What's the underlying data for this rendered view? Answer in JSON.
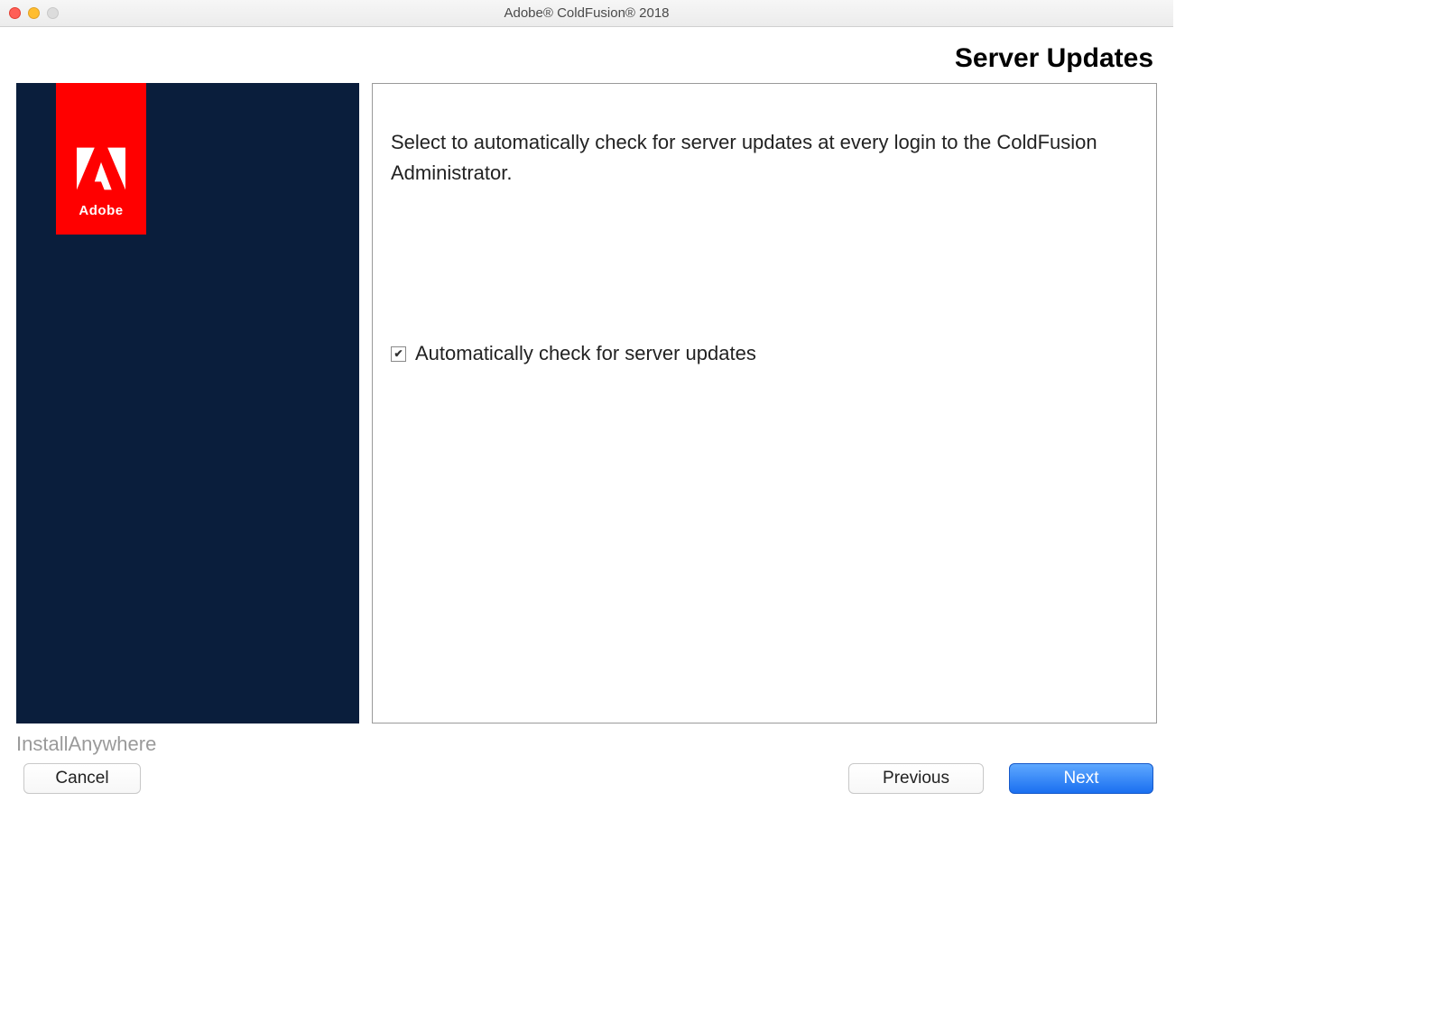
{
  "window": {
    "title": "Adobe® ColdFusion® 2018"
  },
  "header": {
    "title": "Server Updates"
  },
  "sidebar": {
    "brand": "Adobe"
  },
  "content": {
    "description": "Select to automatically check for server updates at every login to the ColdFusion Administrator.",
    "checkbox": {
      "label": "Automatically check for server updates",
      "checked": true,
      "mark": "✔"
    }
  },
  "footer": {
    "brand": "InstallAnywhere",
    "buttons": {
      "cancel": "Cancel",
      "previous": "Previous",
      "next": "Next"
    }
  }
}
